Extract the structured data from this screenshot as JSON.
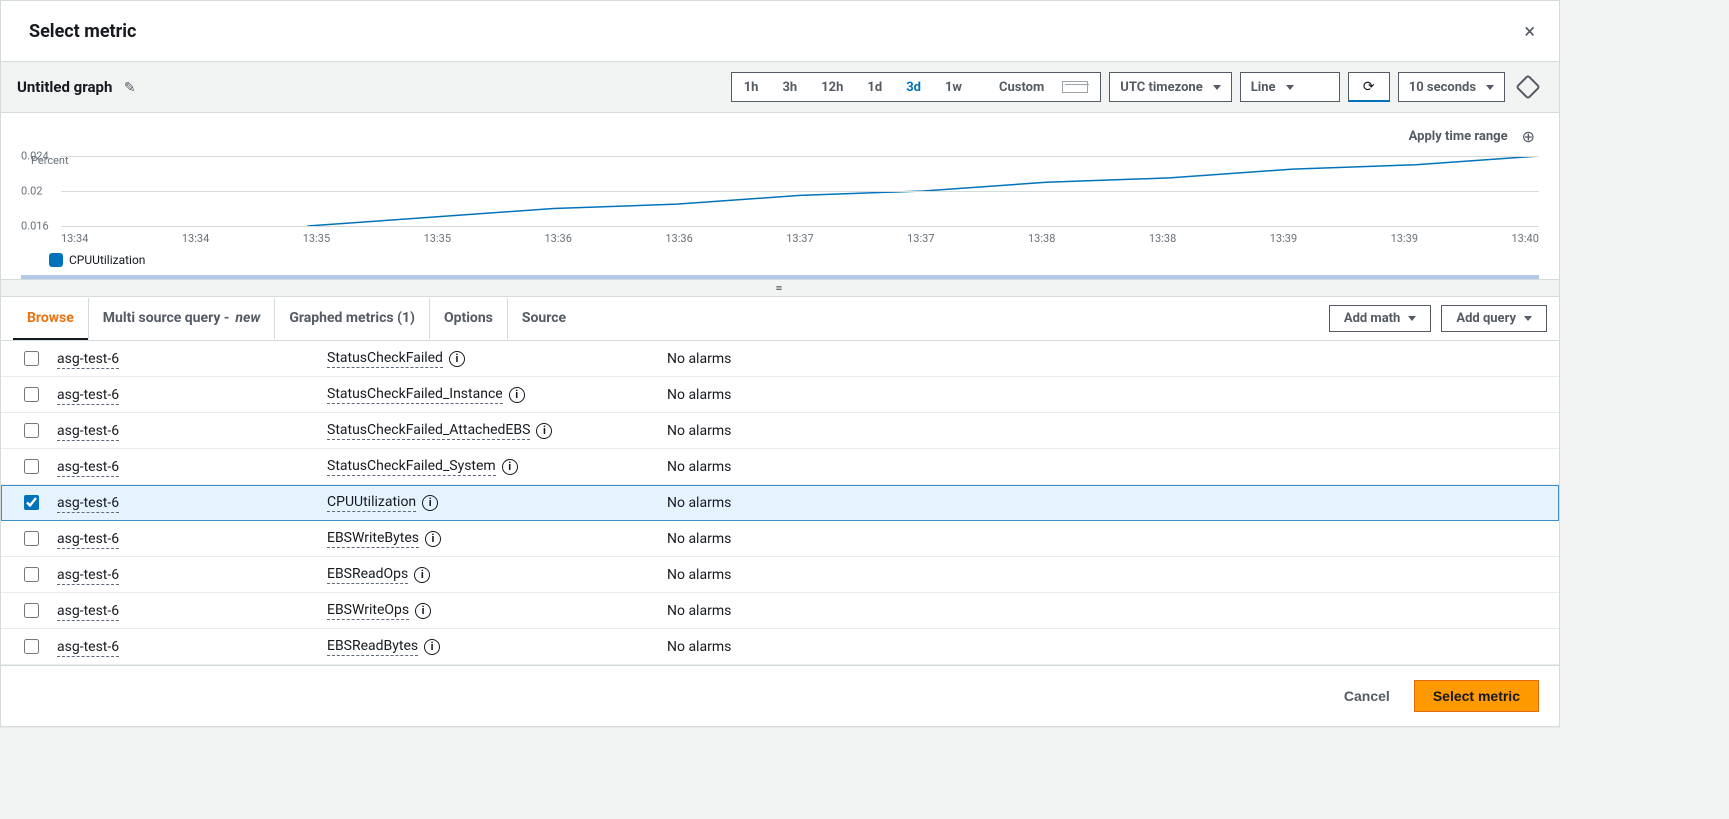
{
  "modal": {
    "title": "Select metric",
    "close_label": "×"
  },
  "graph": {
    "title": "Untitled graph",
    "apply_time_range": "Apply time range",
    "ylabel": "Percent",
    "legend_series": "CPUUtilization"
  },
  "time_range": {
    "options": [
      "1h",
      "3h",
      "12h",
      "1d",
      "3d",
      "1w"
    ],
    "active": "3d",
    "custom_label": "Custom"
  },
  "timezone": {
    "selected": "UTC timezone"
  },
  "graph_type": {
    "selected": "Line"
  },
  "refresh_interval": {
    "selected": "10 seconds"
  },
  "tabs": {
    "browse": "Browse",
    "multi_source_a": "Multi source query - ",
    "multi_source_b": "new",
    "graphed_metrics": "Graphed metrics (1)",
    "options": "Options",
    "source": "Source"
  },
  "actions": {
    "add_math": "Add math",
    "add_query": "Add query"
  },
  "metrics": {
    "rows": [
      {
        "asg": "asg-test-6",
        "name": "StatusCheckFailed",
        "alarm": "No alarms",
        "checked": false
      },
      {
        "asg": "asg-test-6",
        "name": "StatusCheckFailed_Instance",
        "alarm": "No alarms",
        "checked": false
      },
      {
        "asg": "asg-test-6",
        "name": "StatusCheckFailed_AttachedEBS",
        "alarm": "No alarms",
        "checked": false
      },
      {
        "asg": "asg-test-6",
        "name": "StatusCheckFailed_System",
        "alarm": "No alarms",
        "checked": false
      },
      {
        "asg": "asg-test-6",
        "name": "CPUUtilization",
        "alarm": "No alarms",
        "checked": true
      },
      {
        "asg": "asg-test-6",
        "name": "EBSWriteBytes",
        "alarm": "No alarms",
        "checked": false
      },
      {
        "asg": "asg-test-6",
        "name": "EBSReadOps",
        "alarm": "No alarms",
        "checked": false
      },
      {
        "asg": "asg-test-6",
        "name": "EBSWriteOps",
        "alarm": "No alarms",
        "checked": false
      },
      {
        "asg": "asg-test-6",
        "name": "EBSReadBytes",
        "alarm": "No alarms",
        "checked": false
      }
    ]
  },
  "footer": {
    "cancel": "Cancel",
    "select": "Select metric"
  },
  "chart_data": {
    "type": "line",
    "title": "",
    "xlabel": "",
    "ylabel": "Percent",
    "ylim": [
      0.016,
      0.024
    ],
    "yticks": [
      0.016,
      0.02,
      0.024
    ],
    "x": [
      "13:34",
      "13:34",
      "13:35",
      "13:35",
      "13:36",
      "13:36",
      "13:37",
      "13:37",
      "13:38",
      "13:38",
      "13:39",
      "13:39",
      "13:40"
    ],
    "series": [
      {
        "name": "CPUUtilization",
        "values": [
          null,
          null,
          0.016,
          0.017,
          0.018,
          0.0185,
          0.0195,
          0.02,
          0.021,
          0.0215,
          0.0225,
          0.023,
          0.024
        ]
      }
    ]
  }
}
